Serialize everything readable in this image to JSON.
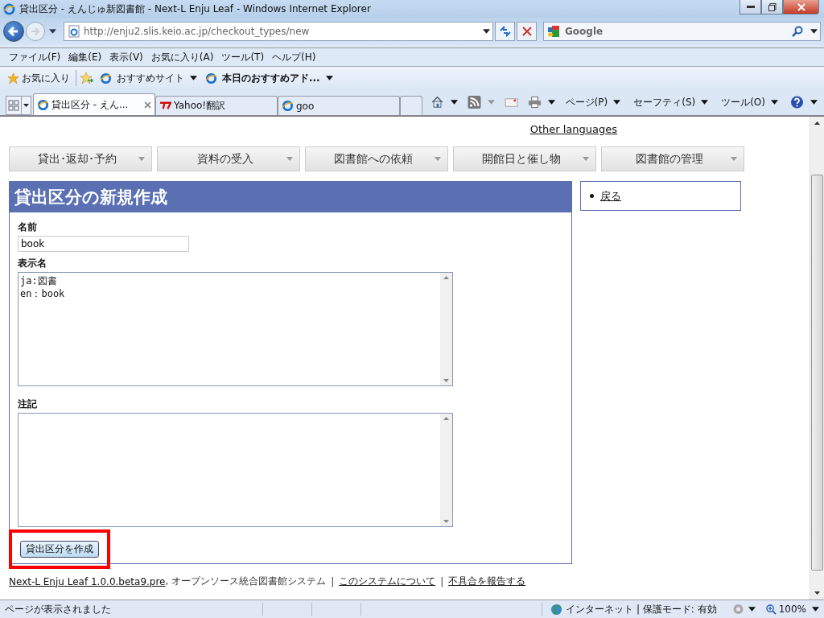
{
  "window": {
    "title": "貸出区分 - えんじゅ新図書館 - Next-L Enju Leaf - Windows Internet Explorer"
  },
  "address_bar": {
    "url": "http://enju2.slis.keio.ac.jp/checkout_types/new"
  },
  "search_box": {
    "placeholder": "Google"
  },
  "menu_bar": [
    "ファイル(F)",
    "編集(E)",
    "表示(V)",
    "お気に入り(A)",
    "ツール(T)",
    "ヘルプ(H)"
  ],
  "favorites_bar": {
    "label": "お気に入り",
    "items": [
      "おすすめサイト",
      "本日のおすすめアド..."
    ]
  },
  "tabs": [
    {
      "label": "貸出区分 - えん...",
      "selected": true
    },
    {
      "label": "Yahoo!翻訳",
      "selected": false
    },
    {
      "label": "goo",
      "selected": false
    }
  ],
  "command_bar": [
    "ページ(P)",
    "セーフティ(S)",
    "ツール(O)"
  ],
  "page": {
    "language_link": "Other languages",
    "nav": [
      "貸出･返却･予約",
      "資料の受入",
      "図書館への依頼",
      "開館日と催し物",
      "図書館の管理"
    ],
    "heading": "貸出区分の新規作成",
    "back_link": "戻る",
    "fields": [
      {
        "label": "名前",
        "kind": "input",
        "value": "book"
      },
      {
        "label": "表示名",
        "kind": "textarea",
        "value": "ja:図書\nen：book"
      },
      {
        "label": "注記",
        "kind": "textarea"
      }
    ],
    "submit_button": {
      "label": "貸出区分を作成",
      "highlighted": true
    },
    "footer": [
      {
        "kind": "link",
        "text": "Next-L Enju Leaf 1.0.0.beta9.pre"
      },
      {
        "kind": "text",
        "text": ", オープンソース統合図書館システム"
      },
      {
        "kind": "text",
        "text": "|"
      },
      {
        "kind": "link",
        "text": "このシステムについて"
      },
      {
        "kind": "text",
        "text": "|"
      },
      {
        "kind": "link",
        "text": "不具合を報告する"
      }
    ]
  },
  "status_bar": {
    "message": "ページが表示されました",
    "zone": "インターネット | 保護モード: 有効",
    "zoom": "100%"
  }
}
